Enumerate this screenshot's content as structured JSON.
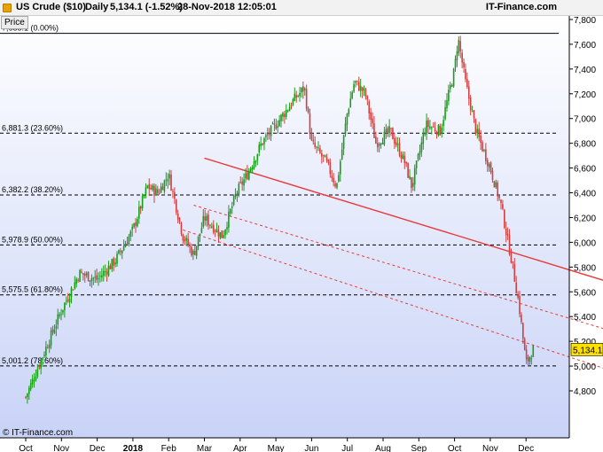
{
  "header": {
    "title": "US Crude ($10)",
    "period": "Daily",
    "price_change": "5,134.1 (-1.52%)",
    "datetime": "28-Nov-2018 12:05:01",
    "brand": "IT-Finance.com"
  },
  "price_tag": "Price",
  "watermark": "© IT-Finance.com",
  "last_price_label": "5,134.1",
  "colors": {
    "up_candle": "#1a9e1a",
    "down_candle": "#d04040",
    "trendline": "#e8393b",
    "fib_line": "#000000",
    "background_top": "#ffffff",
    "background_bottom": "#c9d3f7",
    "last_price_badge": "#ffe000"
  },
  "chart_data": {
    "type": "candlestick",
    "ylim": [
      4600,
      7800
    ],
    "y_ticks": [
      "4,800",
      "5,000",
      "5,200",
      "5,400",
      "5,600",
      "5,800",
      "6,000",
      "6,200",
      "6,400",
      "6,600",
      "6,800",
      "7,000",
      "7,200",
      "7,400",
      "7,600",
      "7,800"
    ],
    "y_tick_values": [
      4800,
      5000,
      5200,
      5400,
      5600,
      5800,
      6000,
      6200,
      6400,
      6600,
      6800,
      7000,
      7200,
      7400,
      7600,
      7800
    ],
    "x_tick_labels": [
      "Oct",
      "Nov",
      "Dec",
      "2018",
      "Feb",
      "Mar",
      "Apr",
      "May",
      "Jun",
      "Jul",
      "Aug",
      "Sep",
      "Oct",
      "Nov",
      "Dec"
    ],
    "fibonacci_levels": [
      {
        "label": "7,688.1 (0.00%)",
        "value": 7688.1
      },
      {
        "label": "6,881.3 (23.60%)",
        "value": 6881.3
      },
      {
        "label": "6,382.2 (38.20%)",
        "value": 6382.2
      },
      {
        "label": "5,978.9 (50.00%)",
        "value": 5978.9
      },
      {
        "label": "5,575.5 (61.80%)",
        "value": 5575.5
      },
      {
        "label": "5,001.2 (78.60%)",
        "value": 5001.2
      }
    ],
    "last_price": 5134.1,
    "close_path": [
      {
        "month": 0.0,
        "price": 4750
      },
      {
        "month": 0.5,
        "price": 5100
      },
      {
        "month": 1.0,
        "price": 5450
      },
      {
        "month": 1.5,
        "price": 5750
      },
      {
        "month": 2.0,
        "price": 5700
      },
      {
        "month": 2.5,
        "price": 5850
      },
      {
        "month": 3.0,
        "price": 6100
      },
      {
        "month": 3.4,
        "price": 6450
      },
      {
        "month": 3.7,
        "price": 6400
      },
      {
        "month": 4.0,
        "price": 6550
      },
      {
        "month": 4.4,
        "price": 6050
      },
      {
        "month": 4.7,
        "price": 5900
      },
      {
        "month": 5.0,
        "price": 6200
      },
      {
        "month": 5.5,
        "price": 6050
      },
      {
        "month": 5.9,
        "price": 6400
      },
      {
        "month": 6.2,
        "price": 6550
      },
      {
        "month": 6.6,
        "price": 6800
      },
      {
        "month": 7.0,
        "price": 6950
      },
      {
        "month": 7.5,
        "price": 7150
      },
      {
        "month": 7.8,
        "price": 7250
      },
      {
        "month": 8.0,
        "price": 6800
      },
      {
        "month": 8.4,
        "price": 6650
      },
      {
        "month": 8.7,
        "price": 6450
      },
      {
        "month": 9.0,
        "price": 7050
      },
      {
        "month": 9.2,
        "price": 7300
      },
      {
        "month": 9.5,
        "price": 7200
      },
      {
        "month": 9.8,
        "price": 6800
      },
      {
        "month": 10.2,
        "price": 6900
      },
      {
        "month": 10.6,
        "price": 6650
      },
      {
        "month": 10.8,
        "price": 6450
      },
      {
        "month": 11.2,
        "price": 6950
      },
      {
        "month": 11.6,
        "price": 6900
      },
      {
        "month": 12.0,
        "price": 7400
      },
      {
        "month": 12.1,
        "price": 7650
      },
      {
        "month": 12.3,
        "price": 7300
      },
      {
        "month": 12.6,
        "price": 6900
      },
      {
        "month": 13.0,
        "price": 6600
      },
      {
        "month": 13.3,
        "price": 6300
      },
      {
        "month": 13.6,
        "price": 5850
      },
      {
        "month": 13.8,
        "price": 5500
      },
      {
        "month": 14.0,
        "price": 5020
      },
      {
        "month": 14.2,
        "price": 5134
      }
    ],
    "trendlines": [
      {
        "style": "solid",
        "points": [
          [
            5.0,
            6680
          ],
          [
            16.2,
            5690
          ]
        ]
      },
      {
        "style": "dashed",
        "points": [
          [
            4.7,
            6300
          ],
          [
            16.2,
            5300
          ]
        ]
      },
      {
        "style": "dashed",
        "points": [
          [
            4.4,
            6100
          ],
          [
            16.2,
            4980
          ]
        ]
      }
    ]
  }
}
